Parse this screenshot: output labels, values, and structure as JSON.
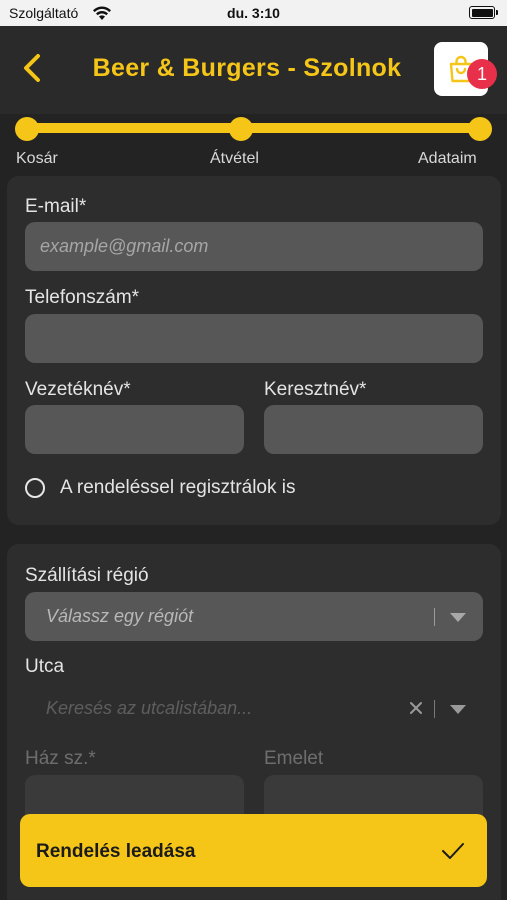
{
  "status_bar": {
    "carrier": "Szolgáltató",
    "time": "du. 3:10"
  },
  "header": {
    "title": "Beer & Burgers - Szolnok",
    "cart_count": "1"
  },
  "steps": [
    {
      "label": "Kosár"
    },
    {
      "label": "Átvétel"
    },
    {
      "label": "Adataim"
    }
  ],
  "contact": {
    "email_label": "E-mail*",
    "email_placeholder": "example@gmail.com",
    "phone_label": "Telefonszám*",
    "lastname_label": "Vezetéknév*",
    "firstname_label": "Keresztnév*",
    "register_label": "A rendeléssel regisztrálok is"
  },
  "delivery": {
    "region_label": "Szállítási régió",
    "region_placeholder": "Válassz egy régiót",
    "street_label": "Utca",
    "street_placeholder": "Keresés az utcalistában...",
    "house_label": "Ház sz.*",
    "floor_label": "Emelet"
  },
  "submit": {
    "label": "Rendelés leadása"
  },
  "colors": {
    "accent": "#f5c518",
    "badge": "#e8304a",
    "background": "#232323"
  }
}
